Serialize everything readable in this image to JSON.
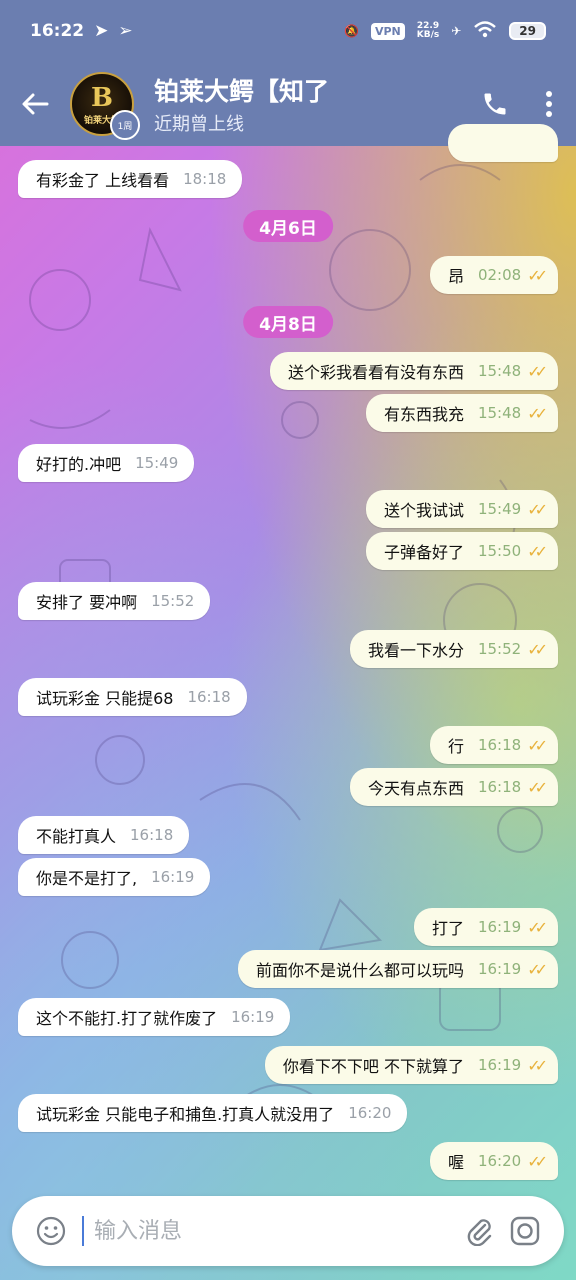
{
  "status_bar": {
    "time": "16:22",
    "vpn": "VPN",
    "net_speed": "22.9",
    "net_unit": "KB/s",
    "battery": "29"
  },
  "header": {
    "title": "铂莱大鳄【知了",
    "subtitle": "近期曾上线",
    "avatar_text": "B",
    "avatar_subtext": "铂莱大鳄",
    "story_label": "1周"
  },
  "dates": [
    {
      "label": "4月6日"
    },
    {
      "label": "4月8日"
    }
  ],
  "messages": [
    {
      "dir": "in",
      "text": "有彩金了 上线看看",
      "time": "18:18"
    },
    {
      "dir": "out",
      "text": "昂",
      "time": "02:08"
    },
    {
      "dir": "out",
      "text": "送个彩我看看有没有东西",
      "time": "15:48"
    },
    {
      "dir": "out",
      "text": "有东西我充",
      "time": "15:48"
    },
    {
      "dir": "in",
      "text": "好打的.冲吧",
      "time": "15:49"
    },
    {
      "dir": "out",
      "text": "送个我试试",
      "time": "15:49"
    },
    {
      "dir": "out",
      "text": "子弹备好了",
      "time": "15:50"
    },
    {
      "dir": "in",
      "text": "安排了 要冲啊",
      "time": "15:52"
    },
    {
      "dir": "out",
      "text": "我看一下水分",
      "time": "15:52"
    },
    {
      "dir": "in",
      "text": "试玩彩金 只能提68",
      "time": "16:18"
    },
    {
      "dir": "out",
      "text": "行",
      "time": "16:18"
    },
    {
      "dir": "out",
      "text": "今天有点东西",
      "time": "16:18"
    },
    {
      "dir": "in",
      "text": "不能打真人",
      "time": "16:18"
    },
    {
      "dir": "in",
      "text": "你是不是打了,",
      "time": "16:19"
    },
    {
      "dir": "out",
      "text": "打了",
      "time": "16:19"
    },
    {
      "dir": "out",
      "text": "前面你不是说什么都可以玩吗",
      "time": "16:19"
    },
    {
      "dir": "in",
      "text": "这个不能打.打了就作废了",
      "time": "16:19"
    },
    {
      "dir": "out",
      "text": "你看下不下吧 不下就算了",
      "time": "16:19"
    },
    {
      "dir": "in",
      "text": "试玩彩金 只能电子和捕鱼.打真人就没用了",
      "time": "16:20"
    },
    {
      "dir": "out",
      "text": "喔",
      "time": "16:20"
    }
  ],
  "input": {
    "placeholder": "输入消息"
  },
  "colors": {
    "header_bg": "#6b7eb0",
    "date_pill": "#d35fcd",
    "read_ticks": "#e8b23c"
  }
}
